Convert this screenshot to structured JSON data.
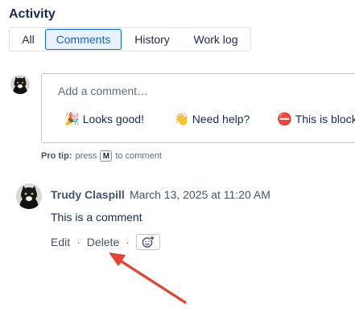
{
  "activity": {
    "title": "Activity",
    "tabs": [
      {
        "label": "All"
      },
      {
        "label": "Comments",
        "selected": true
      },
      {
        "label": "History"
      },
      {
        "label": "Work log"
      }
    ]
  },
  "composer": {
    "placeholder": "Add a comment…",
    "quick_replies": [
      {
        "emoji": "🎉",
        "label": "Looks good!"
      },
      {
        "emoji": "👋",
        "label": "Need help?"
      },
      {
        "emoji": "⛔",
        "label": "This is blocking"
      }
    ]
  },
  "protip": {
    "label": "Pro tip:",
    "before_key": "press",
    "key": "M",
    "after_key": "to comment"
  },
  "comment": {
    "author": "Trudy Claspill",
    "timestamp": "March 13, 2025 at 11:20 AM",
    "body": "This is a comment",
    "actions": {
      "edit": "Edit",
      "separator": "·",
      "delete": "Delete"
    },
    "reaction_icon": "add-reaction-icon"
  },
  "colors": {
    "accent": "#0c66e4",
    "arrow": "#e8412c"
  }
}
